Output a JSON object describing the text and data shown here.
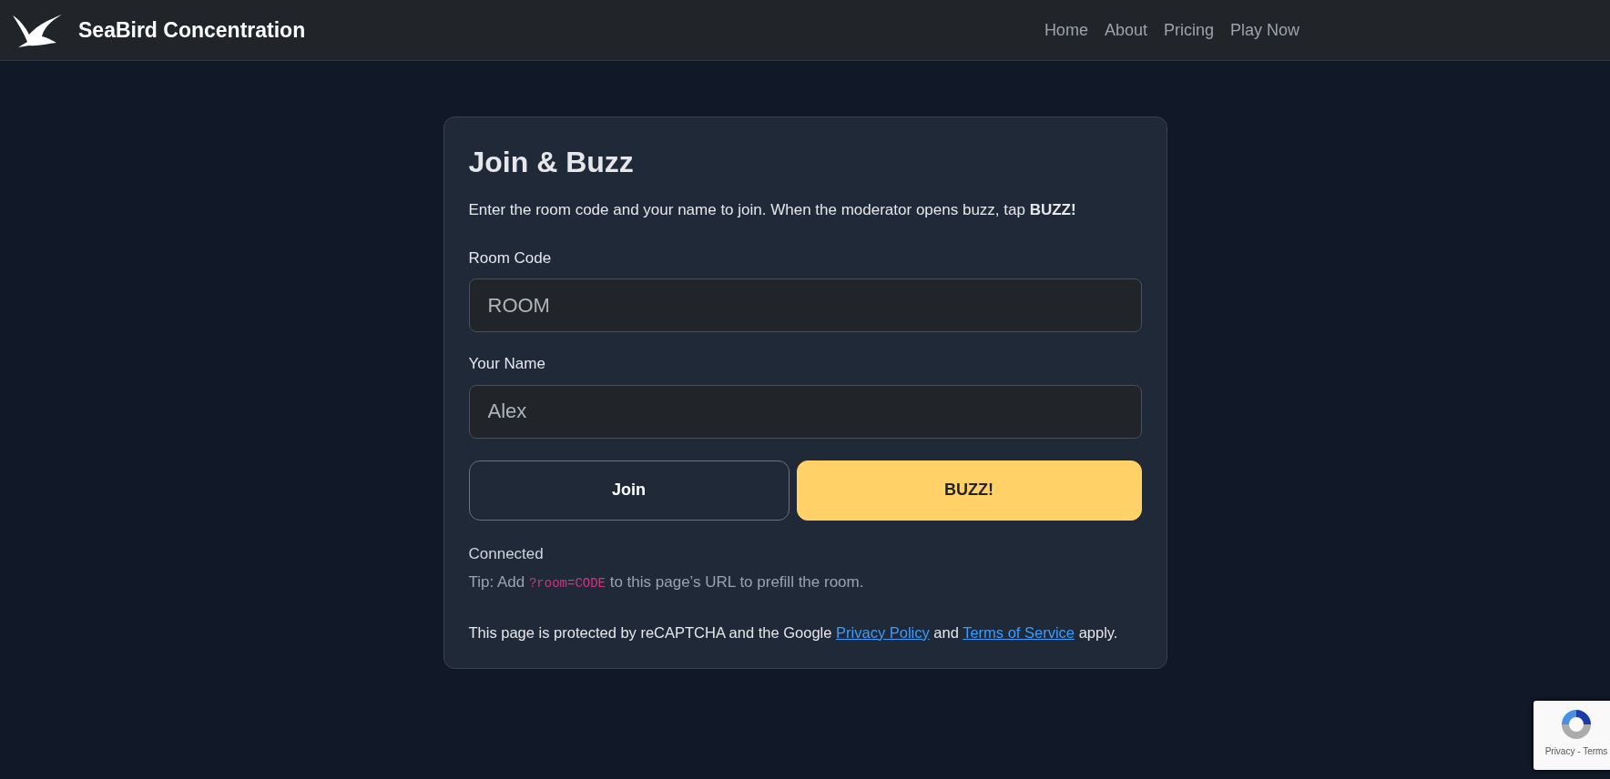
{
  "navbar": {
    "brand": "SeaBird Concentration",
    "links": [
      {
        "label": "Home"
      },
      {
        "label": "About"
      },
      {
        "label": "Pricing"
      },
      {
        "label": "Play Now"
      }
    ]
  },
  "card": {
    "title": "Join & Buzz",
    "intro": "Enter the room code and your name to join. When the moderator opens buzz, tap **BUZZ!**",
    "fields": [
      {
        "label": "Room Code",
        "placeholder": "ROOM"
      },
      {
        "label": "Your Name",
        "placeholder": "Alex"
      }
    ],
    "buttons": [
      {
        "label": "Join",
        "kind": "outline"
      },
      {
        "label": "BUZZ!",
        "kind": "warning"
      }
    ],
    "status": "Connected",
    "tip": {
      "before": "Tip: Add",
      "code": "?room=CODE",
      "after": "to this page’s URL to prefill the room."
    },
    "recaptcha_notice": {
      "before": "This page is protected by reCAPTCHA and the Google",
      "link_1": "Privacy Policy",
      "middle": "and",
      "link_2": "Terms of Service",
      "after": "apply."
    }
  },
  "recaptcha_badge": {
    "links": "Privacy - Terms"
  }
}
